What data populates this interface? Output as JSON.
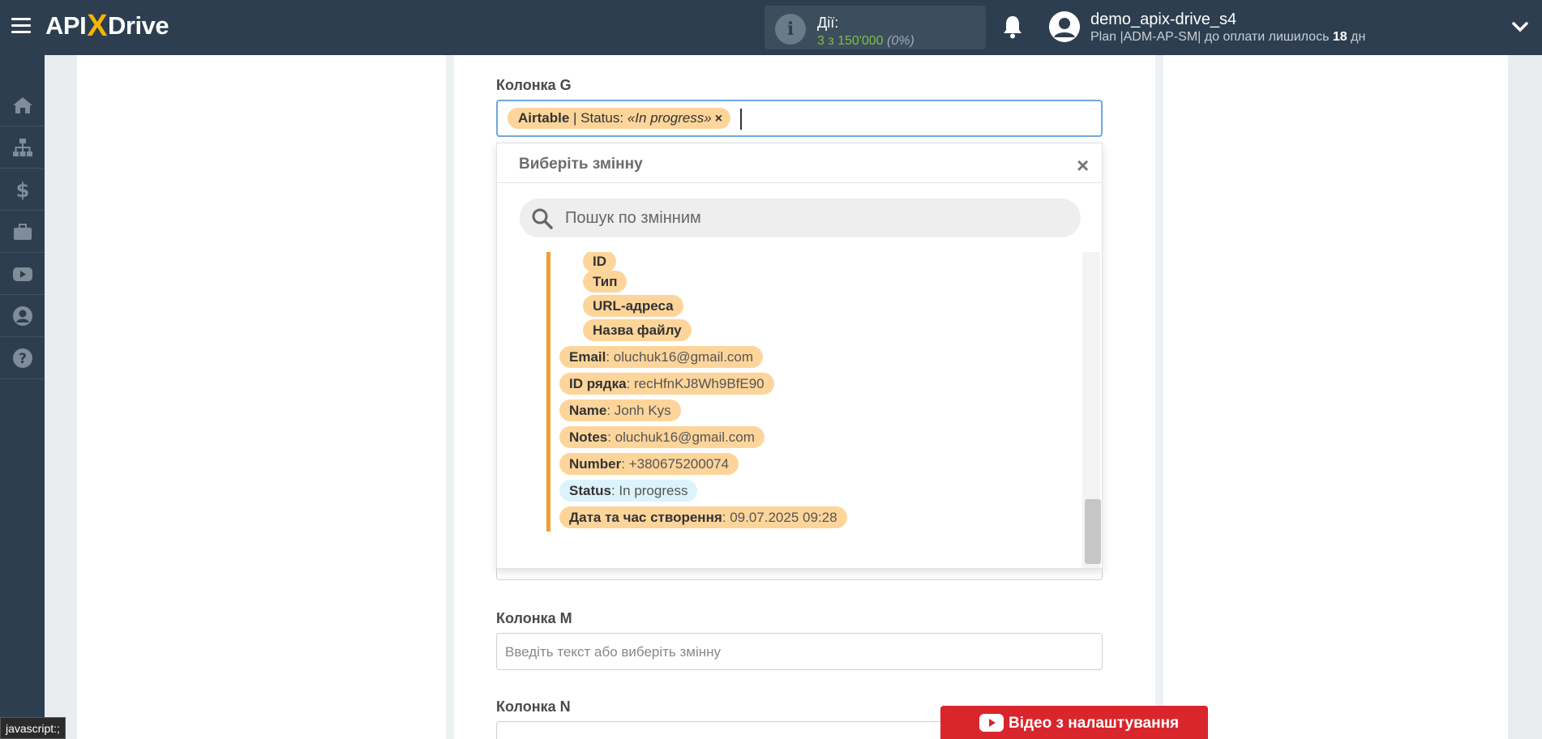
{
  "header": {
    "logo_api": "API",
    "logo_x": "X",
    "logo_drive": "Drive",
    "actions_label": "Дії:",
    "actions_value": "3 з 150'000",
    "actions_percent": "(0%)",
    "user_name": "demo_apix-drive_s4",
    "plan_prefix": "Plan |ADM-AP-SM| до оплати лишилось ",
    "plan_days": "18",
    "plan_suffix": " дн"
  },
  "sidebar": {
    "items": [
      "home-icon",
      "sitemap-icon",
      "dollar-icon",
      "briefcase-icon",
      "youtube-icon",
      "user-icon",
      "help-icon"
    ]
  },
  "fields": {
    "g_label": "Колонка G",
    "g_tag_source": "Airtable",
    "g_tag_sep": " | Status: ",
    "g_tag_value": "«In progress»",
    "g_tag_close": "×",
    "m_label": "Колонка M",
    "m_placeholder": "Введіть текст або виберіть змінну",
    "n_label": "Колонка N"
  },
  "dropdown": {
    "title": "Виберіть змінну",
    "close": "×",
    "search_placeholder": "Пошук по змінним",
    "sub_items": [
      "ID",
      "Тип",
      "URL-адреса",
      "Назва файлу"
    ],
    "items": [
      {
        "key": "Email",
        "value": ": oluchuk16@gmail.com"
      },
      {
        "key": "ID рядка",
        "value": ": recHfnKJ8Wh9BfE90"
      },
      {
        "key": "Name",
        "value": ": Jonh Kys"
      },
      {
        "key": "Notes",
        "value": ": oluchuk16@gmail.com"
      },
      {
        "key": "Number",
        "value": ": +380675200074"
      },
      {
        "key": "Status",
        "value": ": In progress"
      },
      {
        "key": "Дата та час створення",
        "value": ": 09.07.2025 09:28"
      }
    ]
  },
  "video_button": "Відео з налаштування",
  "status_tip": "javascript:;"
}
